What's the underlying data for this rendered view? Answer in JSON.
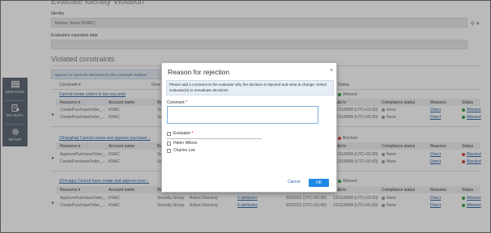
{
  "page": {
    "title": "Evaluate Identity Violation",
    "identity_label": "Identity",
    "identity_value": "Nelson, Kevin [KNAC]",
    "expiration_label": "Evaluation expiration date",
    "section_title": "Violated constraints",
    "note": "Approve or reject the decisions for the constraint violation",
    "columns_top": {
      "constraint": "Constraint",
      "desc": "Desc",
      "status": "Status"
    },
    "groups": [
      {
        "constraint": "Cannot create orders in two org units",
        "status": "Allowed",
        "status_color": "#2e9e46",
        "sub_headers": {
          "resource": "Resource",
          "account": "Account name",
          "re": "Re",
          "valid_to": "Valid to",
          "compliance": "Compliance status",
          "reasons": "Reasons",
          "status": "Status"
        },
        "rows": [
          {
            "resource": "CreatePurchaseOrder_...",
            "account": "KNAC",
            "re": "Se",
            "valid_to": "12/31/9999 (UTC+01:00)",
            "compliance": "None",
            "reasons": "Direct",
            "status": "Allowed"
          },
          {
            "resource": "CreatePurchaseOrder_...",
            "account": "KNAC",
            "re": "Se",
            "valid_to": "12/31/9999 (UTC+01:00)",
            "compliance": "None",
            "reasons": "Direct",
            "status": "Allowed"
          }
        ]
      },
      {
        "constraint": "(Shanghai) Cannot create and approve purchase...",
        "status": "Blocked",
        "status_color": "#d13b3b",
        "sub_headers": {
          "resource": "Resource",
          "account": "Account name",
          "re": "Re",
          "valid_to": "Valid to",
          "compliance": "Compliance status",
          "reasons": "Reasons",
          "status": "Status"
        },
        "rows": [
          {
            "resource": "ApprovePurchaseOrder_...",
            "account": "KNAC",
            "re": "Se",
            "valid_to": "12/31/9999 (UTC+01:00)",
            "compliance": "None",
            "reasons": "Direct",
            "status": "Blocked"
          },
          {
            "resource": "CreatePurchaseOrder_...",
            "account": "KNAC",
            "re": "Se",
            "valid_to": "12/31/9999 (UTC+01:00)",
            "compliance": "None",
            "reasons": "Direct",
            "status": "Blocked"
          }
        ]
      },
      {
        "constraint": "(Chicago) Cannot have create and approve purc...",
        "status": "Allowed",
        "status_color": "#2e9e46",
        "sub_headers": {
          "resource": "Resource",
          "account": "Account name",
          "re": "Re",
          "valid_to": "Valid to",
          "compliance": "Compliance status",
          "reasons": "Reasons",
          "status": "Status"
        },
        "rows": [
          {
            "resource": "ApprovePurchaseOrder_...",
            "account": "KNAC",
            "re": "Security Group",
            "system": "Active Directory",
            "attrs": "5 attributes",
            "valid_from": "8/3/2021 (UTC+01:00)",
            "valid_to": "12/31/9999 (UTC+01:00)",
            "compliance": "None",
            "reasons": "Direct",
            "status": "Allowed"
          },
          {
            "resource": "CreatePurchaseOrder_...",
            "account": "KNAC",
            "re": "Security Group",
            "system": "Active Directory",
            "attrs": "5 attributes",
            "valid_from": "8/3/2021 (UTC+01:00)",
            "valid_to": "12/31/9999 (UTC+01:00)",
            "compliance": "None",
            "reasons": "Direct",
            "status": "Allowed"
          }
        ]
      }
    ]
  },
  "sidebar": {
    "items": [
      {
        "label": "SERVICES",
        "icon": "services-icon"
      },
      {
        "label": "MY DATA",
        "icon": "my-data-icon"
      },
      {
        "label": "SETUP",
        "icon": "gear-icon"
      }
    ]
  },
  "modal": {
    "title": "Reason for rejection",
    "info": "Please add a comment to the evaluator why the decision is rejected and what to change. Select evaluator(s) to reevaluate decisions",
    "comment_label": "Comment",
    "comment_value": "",
    "evaluator_label": "Evaluator",
    "required_mark": "*",
    "evaluators": [
      "Helen Wilson",
      "Charles Lee"
    ],
    "cancel_label": "Cancel",
    "ok_label": "OK"
  }
}
